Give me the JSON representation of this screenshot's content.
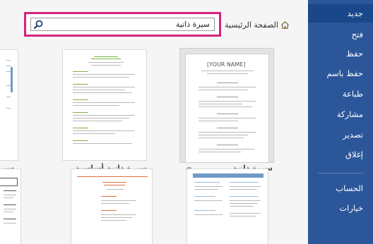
{
  "sidebar": {
    "items": [
      {
        "label": "جديد",
        "active": true
      },
      {
        "label": "فتح"
      },
      {
        "label": "حفظ"
      },
      {
        "label": "حفظ باسم"
      },
      {
        "label": "طباعة"
      },
      {
        "label": "مشاركة"
      },
      {
        "label": "تصدير"
      },
      {
        "label": "إغلاق"
      },
      {
        "label": "الحساب"
      },
      {
        "label": "خيارات"
      }
    ]
  },
  "header": {
    "breadcrumb": "الصفحة الرئيسية",
    "search_value": "سيرة ذاتية",
    "home_icon": "home-icon",
    "search_icon": "search-icon"
  },
  "templates": [
    {
      "title": "سيرة ذاتية",
      "sample_name": "[YOUR NAME]",
      "selected": true
    },
    {
      "title": "سيرة ذاتية أساسية"
    },
    {
      "title": "سيرة ذاتية"
    }
  ],
  "colors": {
    "sidebar_bg": "#2b579a",
    "sidebar_active": "#19478a",
    "search_highlight": "#d6227e",
    "accent_green": "#7cb342",
    "accent_orange": "#e0713a"
  }
}
